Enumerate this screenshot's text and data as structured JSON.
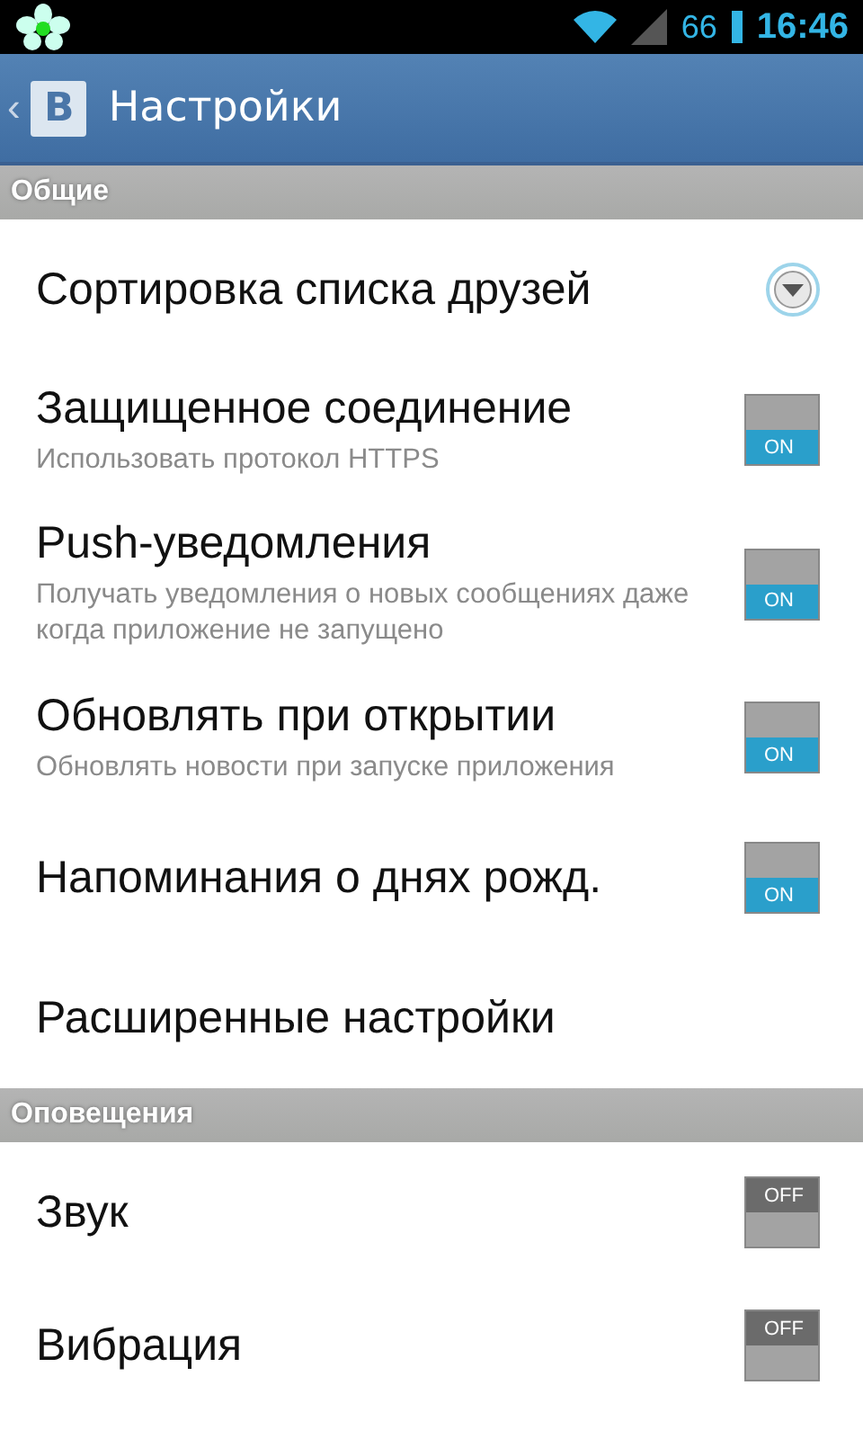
{
  "status_bar": {
    "signal_text": "66",
    "time": "16:46"
  },
  "action_bar": {
    "back": "‹",
    "logo": "B",
    "title": "Настройки"
  },
  "sections": [
    {
      "header": "Общие",
      "items": [
        {
          "kind": "dropdown",
          "title": "Сортировка списка друзей"
        },
        {
          "kind": "toggle",
          "title": "Защищенное соединение",
          "summary": "Использовать протокол HTTPS",
          "on": true,
          "toggle_label": "ON"
        },
        {
          "kind": "toggle",
          "title": "Push-уведомления",
          "summary": "Получать уведомления о новых сообщениях даже когда приложение не запущено",
          "on": true,
          "toggle_label": "ON"
        },
        {
          "kind": "toggle",
          "title": "Обновлять при открытии",
          "summary": "Обновлять новости при запуске приложения",
          "on": true,
          "toggle_label": "ON"
        },
        {
          "kind": "toggle",
          "title": "Напоминания о днях рожд.",
          "on": true,
          "toggle_label": "ON"
        },
        {
          "kind": "link",
          "title": "Расширенные настройки"
        }
      ]
    },
    {
      "header": "Оповещения",
      "items": [
        {
          "kind": "toggle",
          "title": "Звук",
          "on": false,
          "toggle_label": "OFF"
        },
        {
          "kind": "toggle",
          "title": "Вибрация",
          "on": false,
          "toggle_label": "OFF"
        }
      ]
    }
  ]
}
